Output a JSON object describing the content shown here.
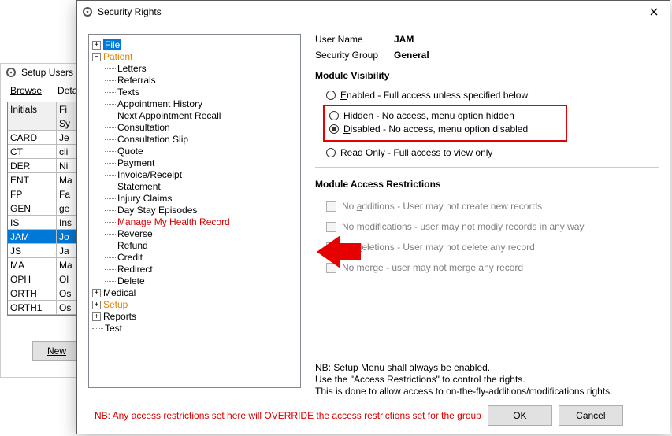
{
  "back_window": {
    "title": "Setup Users",
    "tabs": [
      "Browse",
      "Details"
    ],
    "grid": {
      "headers": [
        "Initials",
        "Fi"
      ],
      "subheader": [
        "",
        "Sy"
      ],
      "rows": [
        {
          "c1": "CARD",
          "c2": "Je"
        },
        {
          "c1": "CT",
          "c2": "cli"
        },
        {
          "c1": "DER",
          "c2": "Ni"
        },
        {
          "c1": "ENT",
          "c2": "Ma"
        },
        {
          "c1": "FP",
          "c2": "Fa"
        },
        {
          "c1": "GEN",
          "c2": "ge"
        },
        {
          "c1": "IS",
          "c2": "Ins"
        },
        {
          "c1": "JAM",
          "c2": "Jo",
          "selected": true
        },
        {
          "c1": "JS",
          "c2": "Ja"
        },
        {
          "c1": "MA",
          "c2": "Ma"
        },
        {
          "c1": "OPH",
          "c2": "Ol"
        },
        {
          "c1": "ORTH",
          "c2": "Os"
        },
        {
          "c1": "ORTH1",
          "c2": "Os"
        }
      ]
    },
    "new_btn": "New"
  },
  "front_window": {
    "title": "Security Rights",
    "tree": {
      "root": [
        {
          "label": "File",
          "state": "collapsed",
          "selected": true
        },
        {
          "label": "Patient",
          "state": "expanded",
          "orange": true,
          "children": [
            "Letters",
            "Referrals",
            "Texts",
            "Appointment History",
            "Next Appointment Recall",
            "Consultation",
            "Consultation Slip",
            "Quote",
            "Payment",
            "Invoice/Receipt",
            "Statement",
            "Injury Claims",
            "Day Stay Episodes",
            {
              "label": "Manage My Health Record",
              "red": true
            },
            "Reverse",
            "Refund",
            "Credit",
            "Redirect",
            "Delete"
          ]
        },
        {
          "label": "Medical",
          "state": "collapsed"
        },
        {
          "label": "Setup",
          "state": "collapsed",
          "orange": true
        },
        {
          "label": "Reports",
          "state": "collapsed"
        },
        {
          "label": "Test",
          "state": "leaf"
        }
      ]
    },
    "details": {
      "user_name_label": "User Name",
      "user_name": "JAM",
      "security_group_label": "Security Group",
      "security_group": "General",
      "module_visibility_title": "Module Visibility",
      "visibility_options": {
        "enabled": "Enabled - Full access unless specified below",
        "hidden": "Hidden - No access, menu option hidden",
        "disabled": "Disabled - No access, menu option disabled",
        "readonly": "Read Only - Full access to view only"
      },
      "visibility_selected": "disabled",
      "restrictions_title": "Module Access Restrictions",
      "restrictions": {
        "add": "No additions - User may not create new records",
        "mod": "No modifications - user may not modiy records in any way",
        "del": "No deletions - User may not delete any record",
        "merge": "No merge - user may not merge any record"
      },
      "nb": {
        "l1": "NB: Setup Menu shall always be enabled.",
        "l2": "Use the \"Access Restrictions\" to control the rights.",
        "l3": "This is done to allow access to on-the-fly-additions/modifications rights."
      }
    },
    "footer_note": "NB: Any access restrictions set here will OVERRIDE the access restrictions set for the group",
    "ok": "OK",
    "cancel": "Cancel"
  }
}
